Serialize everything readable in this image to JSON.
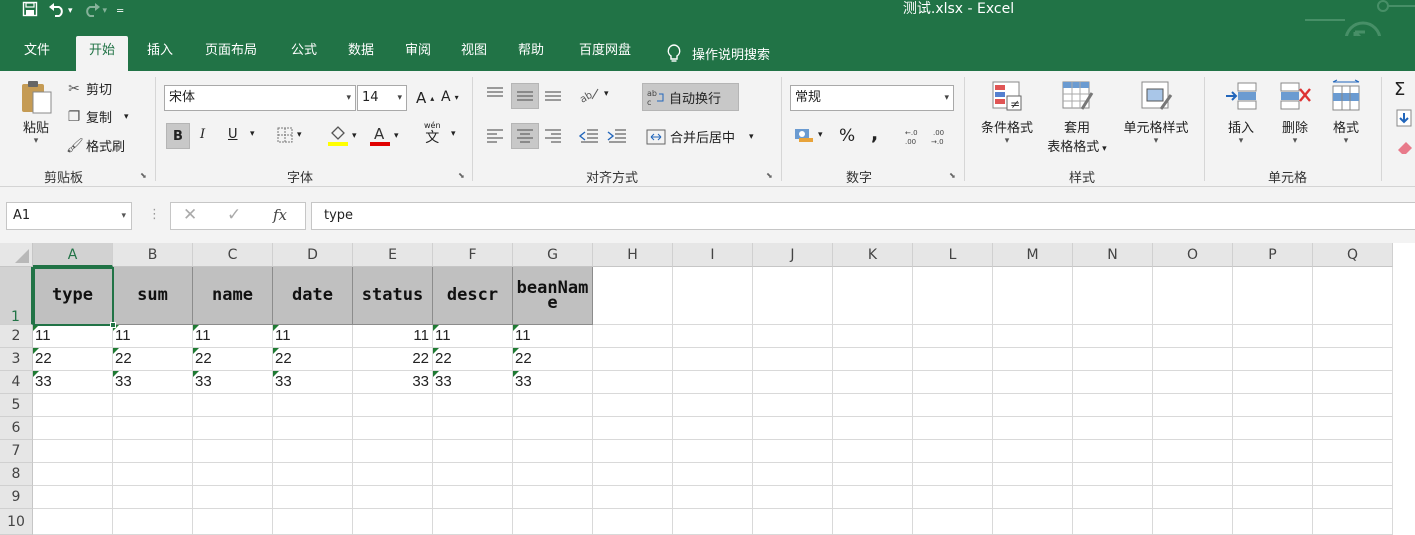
{
  "window": {
    "title": "测试.xlsx  -  Excel"
  },
  "colors": {
    "brand": "#217346",
    "header_fill": "#c0c0c0",
    "comment_marker": "#1f7a33"
  },
  "qat": {
    "save_icon": "save-icon",
    "undo_icon": "undo-icon",
    "redo_icon": "redo-icon",
    "customize_icon": "customize-qat-icon"
  },
  "tabs": [
    "文件",
    "开始",
    "插入",
    "页面布局",
    "公式",
    "数据",
    "审阅",
    "视图",
    "帮助",
    "百度网盘"
  ],
  "active_tab": "开始",
  "tellme": {
    "label": "操作说明搜索"
  },
  "clipboard": {
    "paste": "粘贴",
    "cut": "剪切",
    "copy": "复制",
    "format_painter": "格式刷",
    "group": "剪贴板"
  },
  "font": {
    "name": "宋体",
    "size": "14",
    "bold": "B",
    "italic": "I",
    "underline": "U",
    "wen": "wén",
    "wen_char": "文",
    "group": "字体"
  },
  "alignment": {
    "wrap": "自动换行",
    "merge": "合并后居中",
    "group": "对齐方式"
  },
  "number": {
    "format": "常规",
    "percent": "%",
    "comma": ",",
    "group": "数字"
  },
  "styles": {
    "conditional": "条件格式",
    "table_line1": "套用",
    "table_line2": "表格格式",
    "cell_styles": "单元格样式",
    "group": "样式"
  },
  "cells": {
    "insert": "插入",
    "delete": "删除",
    "format": "格式",
    "group": "单元格"
  },
  "formula_bar": {
    "name_box": "A1",
    "fx": "fx",
    "value": "type"
  },
  "columns": [
    "A",
    "B",
    "C",
    "D",
    "E",
    "F",
    "G",
    "H",
    "I",
    "J",
    "K",
    "L",
    "M",
    "N",
    "O",
    "P",
    "Q"
  ],
  "rows": [
    "1",
    "2",
    "3",
    "4",
    "5",
    "6",
    "7",
    "8",
    "9",
    "10"
  ],
  "sheet": {
    "headers": [
      "type",
      "sum",
      "name",
      "date",
      "status",
      "descr",
      "beanName"
    ],
    "data": [
      [
        "11",
        "11",
        "11",
        "11",
        "11",
        "11",
        "11"
      ],
      [
        "22",
        "22",
        "22",
        "22",
        "22",
        "22",
        "22"
      ],
      [
        "33",
        "33",
        "33",
        "33",
        "33",
        "33",
        "33"
      ]
    ]
  }
}
